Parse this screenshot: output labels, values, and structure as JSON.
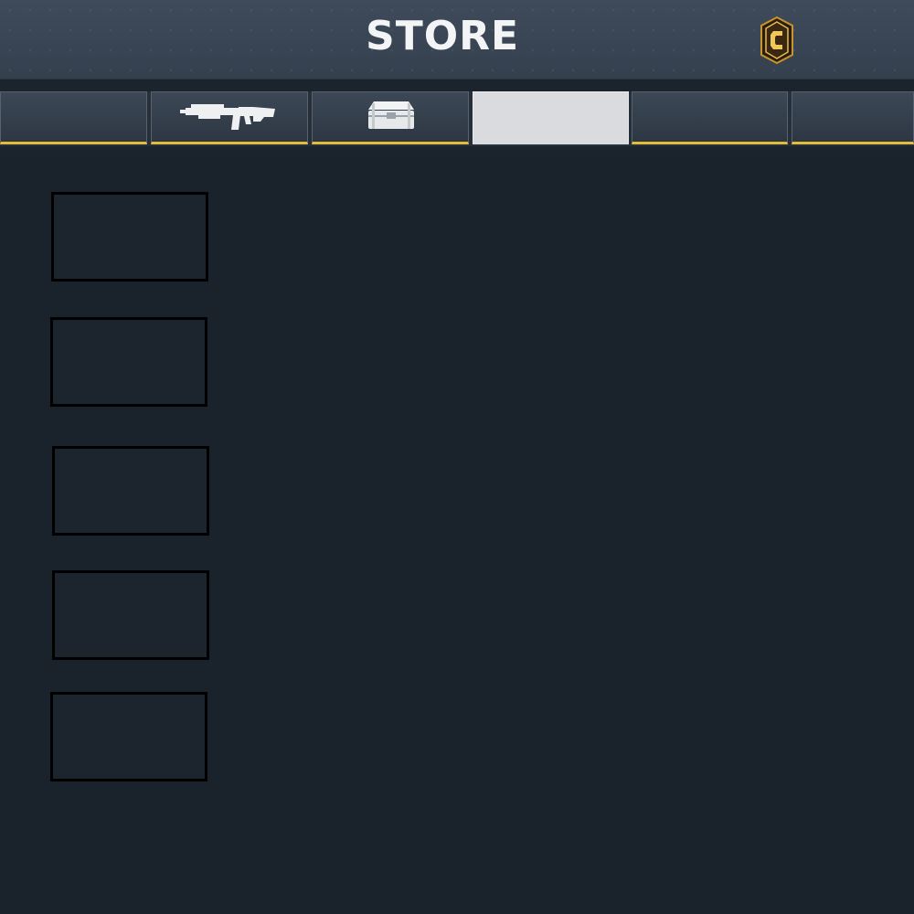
{
  "header": {
    "title": "STORE",
    "badge_icon": "gold-hexagon-c-emblem-icon"
  },
  "tabs": [
    {
      "label": "",
      "icon": null,
      "active": false
    },
    {
      "label": "",
      "icon": "assault-rifle-icon",
      "active": false
    },
    {
      "label": "",
      "icon": "crate-icon",
      "active": false
    },
    {
      "label": "",
      "icon": null,
      "active": true
    },
    {
      "label": "",
      "icon": null,
      "active": false
    },
    {
      "label": "",
      "icon": null,
      "active": false
    }
  ],
  "slots": [
    {
      "label": ""
    },
    {
      "label": ""
    },
    {
      "label": ""
    },
    {
      "label": ""
    },
    {
      "label": ""
    }
  ],
  "colors": {
    "accent": "#e3bd3a",
    "header_bg": "#3a4654",
    "content_bg": "#1a222b",
    "active_tab": "#d9dbde"
  }
}
